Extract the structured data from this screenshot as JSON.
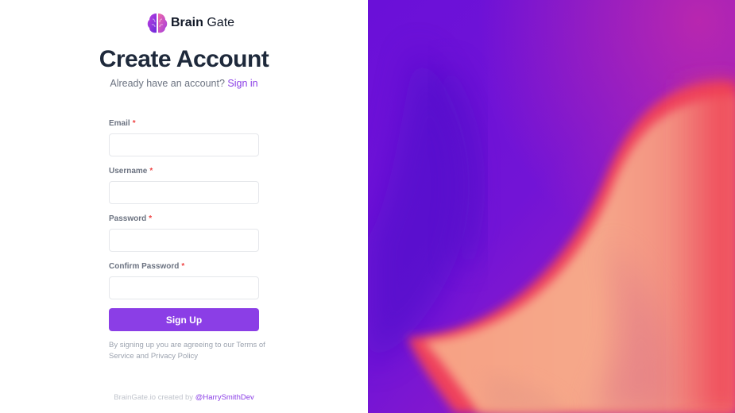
{
  "brand": {
    "logo_icon": "brain-logo-icon",
    "name_bold": "Brain",
    "name_regular": " Gate"
  },
  "header": {
    "title": "Create Account",
    "subtitle_text": "Already have an account? ",
    "signin_link": "Sign in"
  },
  "form": {
    "required_mark": "*",
    "fields": [
      {
        "label": "Email",
        "value": ""
      },
      {
        "label": "Username",
        "value": ""
      },
      {
        "label": "Password",
        "value": ""
      },
      {
        "label": "Confirm Password",
        "value": ""
      }
    ],
    "submit_label": "Sign Up"
  },
  "terms": {
    "prefix": "By signing up you are agreeing to our ",
    "tos": "Terms of Service",
    "and": " and ",
    "privacy": "Privacy Policy"
  },
  "footer": {
    "text": "BrainGate.io created by ",
    "author": "@HarrySmithDev"
  },
  "colors": {
    "accent": "#8b3ee6",
    "required": "#ef4444",
    "title": "#1e293b",
    "bg_purple": "#6a10d8",
    "bg_orange": "#f89a7c",
    "bg_red": "#ef4a5a"
  }
}
